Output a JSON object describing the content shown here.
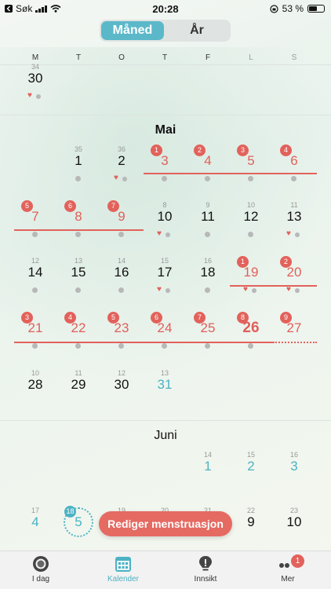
{
  "status_bar": {
    "back_label": "Søk",
    "time": "20:28",
    "battery": "53 %"
  },
  "segmented": {
    "month_label": "Måned",
    "year_label": "År"
  },
  "weekdays": [
    "M",
    "T",
    "O",
    "T",
    "F",
    "L",
    "S"
  ],
  "april_tail": {
    "small_label": "34",
    "day": "30"
  },
  "may": {
    "title": "Mai",
    "days": [
      {
        "d": "1",
        "sm": "35",
        "dot": true
      },
      {
        "d": "2",
        "sm": "36",
        "heart": true,
        "dot": true
      },
      {
        "d": "3",
        "badge": "1",
        "type": "period",
        "dot": true
      },
      {
        "d": "4",
        "badge": "2",
        "type": "period",
        "dot": true
      },
      {
        "d": "5",
        "badge": "3",
        "type": "period",
        "dot": true
      },
      {
        "d": "6",
        "badge": "4",
        "type": "period",
        "dot": true
      },
      {
        "d": "7",
        "badge": "5",
        "type": "period",
        "dot": true
      },
      {
        "d": "8",
        "badge": "6",
        "type": "period",
        "dot": true
      },
      {
        "d": "9",
        "badge": "7",
        "type": "period",
        "dot": true
      },
      {
        "d": "10",
        "sm": "8",
        "heart": true,
        "dot": true
      },
      {
        "d": "11",
        "sm": "9",
        "dot": true
      },
      {
        "d": "12",
        "sm": "10",
        "dot": true
      },
      {
        "d": "13",
        "sm": "11",
        "heart": true,
        "dot": true
      },
      {
        "d": "14",
        "sm": "12",
        "dot": true
      },
      {
        "d": "15",
        "sm": "13",
        "dot": true
      },
      {
        "d": "16",
        "sm": "14",
        "dot": true
      },
      {
        "d": "17",
        "sm": "15",
        "heart": true,
        "dot": true
      },
      {
        "d": "18",
        "sm": "16",
        "dot": true
      },
      {
        "d": "19",
        "badge": "1",
        "type": "period",
        "heart": true,
        "dot": true
      },
      {
        "d": "20",
        "badge": "2",
        "type": "period",
        "heart": true,
        "dot": true
      },
      {
        "d": "21",
        "badge": "3",
        "type": "period",
        "dot": true
      },
      {
        "d": "22",
        "badge": "4",
        "type": "period",
        "dot": true
      },
      {
        "d": "23",
        "badge": "5",
        "type": "period",
        "dot": true
      },
      {
        "d": "24",
        "badge": "6",
        "type": "period",
        "dot": true
      },
      {
        "d": "25",
        "badge": "7",
        "type": "period",
        "dot": true
      },
      {
        "d": "26",
        "badge": "8",
        "type": "period",
        "today": true,
        "dot": true
      },
      {
        "d": "27",
        "badge": "9",
        "type": "period"
      },
      {
        "d": "28",
        "sm": "10"
      },
      {
        "d": "29",
        "sm": "11"
      },
      {
        "d": "30",
        "sm": "12"
      },
      {
        "d": "31",
        "sm": "13",
        "type": "fertile"
      }
    ]
  },
  "june": {
    "title": "Juni",
    "days": [
      {
        "d": "1",
        "sm": "14",
        "type": "fertile"
      },
      {
        "d": "2",
        "sm": "15",
        "type": "fertile"
      },
      {
        "d": "3",
        "sm": "16",
        "type": "fertile"
      },
      {
        "d": "4",
        "sm": "17",
        "type": "fertile"
      },
      {
        "d": "5",
        "badge": "18",
        "type": "fertile",
        "ring": true
      },
      {
        "d": "",
        "sm": "19"
      },
      {
        "d": "",
        "sm": "20"
      },
      {
        "d": "",
        "sm": "21"
      },
      {
        "d": "9",
        "sm": "22"
      },
      {
        "d": "10",
        "sm": "23"
      }
    ]
  },
  "fab_label": "Rediger menstruasjon",
  "tabbar": [
    {
      "label": "I dag",
      "icon": "today-ring-icon"
    },
    {
      "label": "Kalender",
      "icon": "calendar-icon",
      "active": true
    },
    {
      "label": "Innsikt",
      "icon": "lightbulb-icon"
    },
    {
      "label": "Mer",
      "icon": "more-dots-icon",
      "badge": "1"
    }
  ],
  "colors": {
    "accent": "#4cb2c4",
    "period": "#e2625b",
    "fab": "#e56a62"
  }
}
